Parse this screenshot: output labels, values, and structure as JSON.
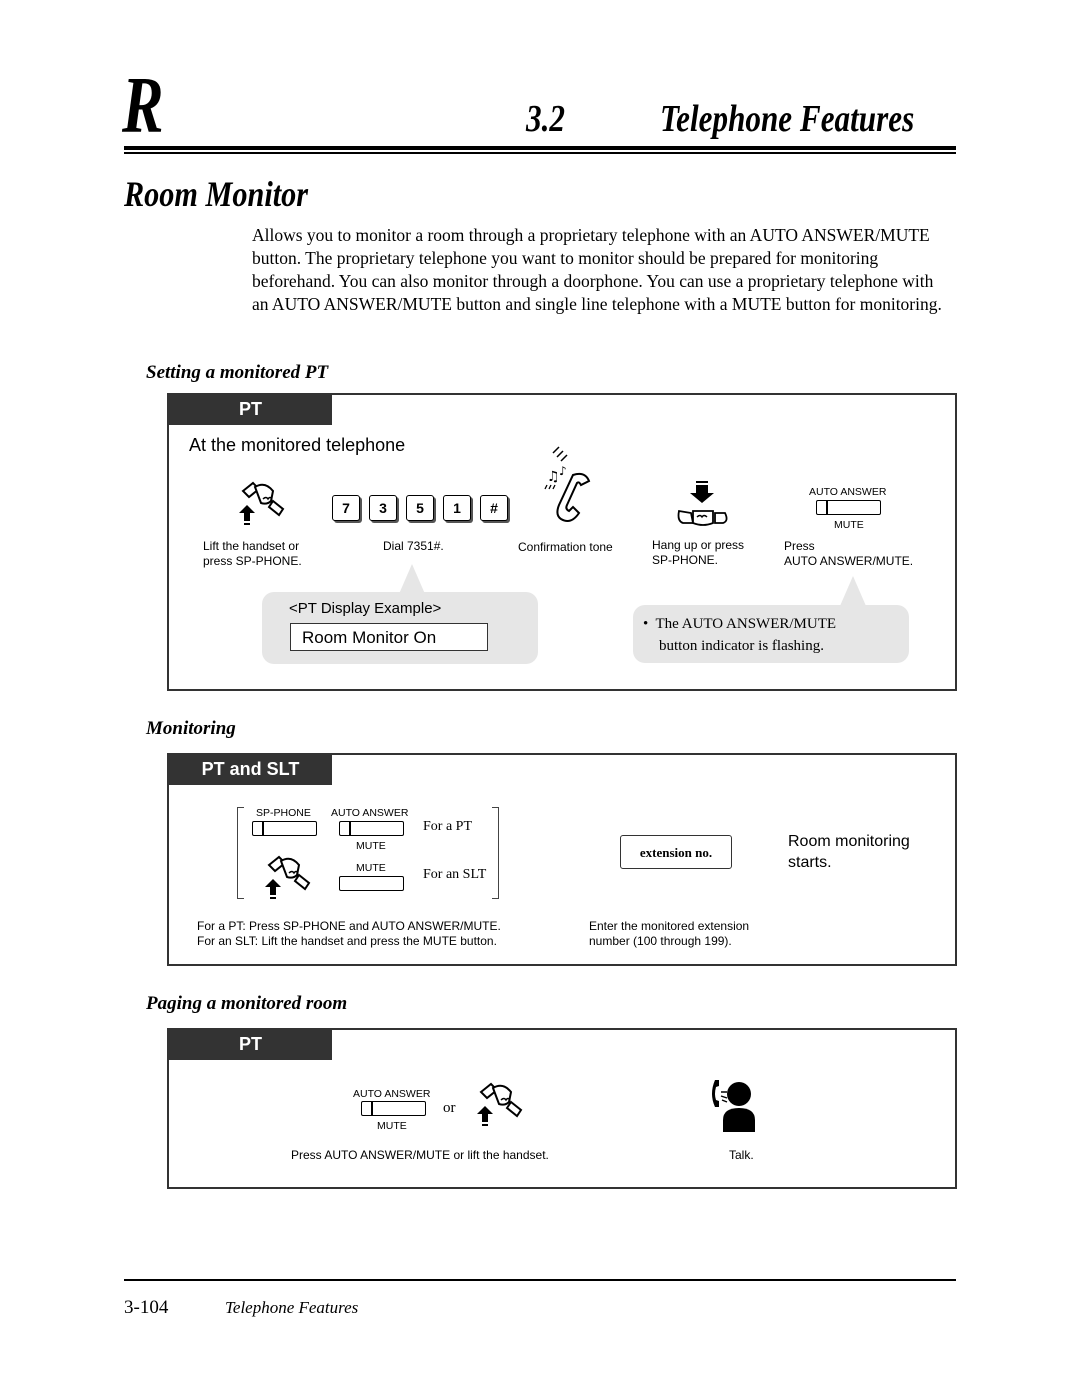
{
  "header": {
    "section_letter": "R",
    "section_number": "3.2",
    "section_title": "Telephone Features"
  },
  "page_title": "Room Monitor",
  "intro_text": "Allows you to monitor a room through a proprietary telephone with an AUTO ANSWER/MUTE button. The proprietary telephone you want to monitor should be prepared for monitoring beforehand. You can also monitor through a doorphone. You can use a proprietary telephone with an AUTO ANSWER/MUTE button and single line telephone with a MUTE button for monitoring.",
  "sections": {
    "setting": {
      "heading": "Setting a monitored PT",
      "tab": "PT",
      "subtitle": "At the monitored telephone",
      "keys": [
        "7",
        "3",
        "5",
        "1",
        "#"
      ],
      "steps": [
        {
          "icon": "lift-handset-icon",
          "caption_line1": "Lift the handset or",
          "caption_line2": "press SP-PHONE."
        },
        {
          "icon": "dial-keys",
          "caption_line1": "Dial 7351#.",
          "caption_line2": ""
        },
        {
          "icon": "confirmation-tone-icon",
          "caption_line1": "Confirmation tone",
          "caption_line2": ""
        },
        {
          "icon": "hang-up-icon",
          "caption_line1": "Hang up or press",
          "caption_line2": "SP-PHONE."
        },
        {
          "icon": "auto-answer-button-icon",
          "caption_line1": "Press",
          "caption_line2": "AUTO ANSWER/MUTE."
        }
      ],
      "button_labels": {
        "top": "AUTO ANSWER",
        "bottom": "MUTE"
      },
      "display_example": {
        "label": "<PT Display Example>",
        "value": "Room Monitor On"
      },
      "note": {
        "bullet": "•",
        "line1": "The AUTO ANSWER/MUTE",
        "line2": "button indicator is flashing."
      }
    },
    "monitoring": {
      "heading": "Monitoring",
      "tab": "PT and SLT",
      "sp_phone_label": "SP-PHONE",
      "auto_answer_label": "AUTO ANSWER",
      "mute_label": "MUTE",
      "mute_label_slt": "MUTE",
      "for_pt": "For a PT",
      "for_slt": "For an SLT",
      "caption_line1": "For a PT:   Press SP-PHONE and AUTO ANSWER/MUTE.",
      "caption_line2": "For an SLT: Lift the handset and press the MUTE button.",
      "extension_box": "extension no.",
      "extension_caption_line1": "Enter the monitored extension",
      "extension_caption_line2": "number (100 through 199).",
      "result_line1": "Room monitoring",
      "result_line2": "starts."
    },
    "paging": {
      "heading": "Paging a monitored room",
      "tab": "PT",
      "auto_answer_label": "AUTO ANSWER",
      "mute_label": "MUTE",
      "or_text": "or",
      "caption": "Press AUTO ANSWER/MUTE or lift the handset.",
      "talk_caption": "Talk."
    }
  },
  "footer": {
    "page_number": "3-104",
    "title": "Telephone Features"
  }
}
